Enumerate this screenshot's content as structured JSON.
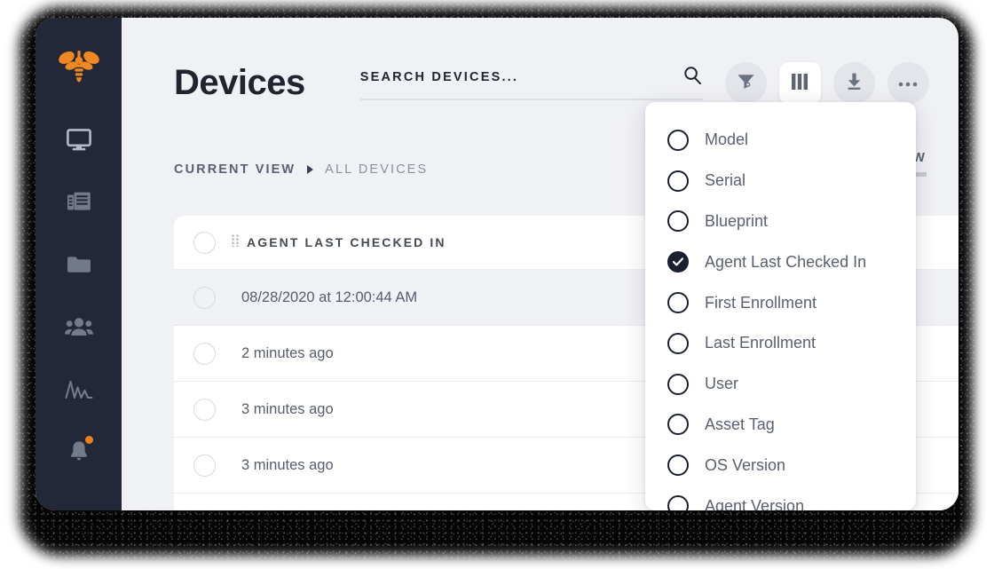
{
  "sidebar": {
    "logo_icon": "bee-logo-icon",
    "items": [
      {
        "icon": "monitor-icon",
        "name": "devices"
      },
      {
        "icon": "documents-icon",
        "name": "blueprints"
      },
      {
        "icon": "folder-icon",
        "name": "library"
      },
      {
        "icon": "users-icon",
        "name": "users"
      },
      {
        "icon": "activity-icon",
        "name": "activity"
      },
      {
        "icon": "bell-icon",
        "name": "notifications",
        "badge": true
      }
    ],
    "background_color": "#232838",
    "logo_color": "#f0811a",
    "badge_color": "#f0811a"
  },
  "header": {
    "title": "Devices",
    "search": {
      "placeholder": "SEARCH DEVICES...",
      "value": "",
      "icon": "search-icon"
    },
    "tools": [
      {
        "label": "Filter",
        "icon": "filter-icon",
        "active": false
      },
      {
        "label": "Columns",
        "icon": "columns-icon",
        "active": true
      },
      {
        "label": "Export",
        "icon": "download-icon",
        "active": false
      },
      {
        "label": "More",
        "icon": "ellipsis-icon",
        "active": false
      }
    ]
  },
  "viewbar": {
    "label": "CURRENT VIEW",
    "value": "ALL DEVICES",
    "reset_label": "RESET VIEW"
  },
  "table": {
    "column_header": "AGENT LAST CHECKED IN",
    "rows": [
      {
        "value": "08/28/2020 at 12:00:44 AM",
        "shaded": true
      },
      {
        "value": "2 minutes ago",
        "shaded": false
      },
      {
        "value": "3 minutes ago",
        "shaded": false
      },
      {
        "value": "3 minutes ago",
        "shaded": false
      },
      {
        "value": "",
        "shaded": false
      }
    ]
  },
  "columns_menu": {
    "items": [
      {
        "label": "Model",
        "checked": false
      },
      {
        "label": "Serial",
        "checked": false
      },
      {
        "label": "Blueprint",
        "checked": false
      },
      {
        "label": "Agent Last Checked In",
        "checked": true
      },
      {
        "label": "First Enrollment",
        "checked": false
      },
      {
        "label": "Last Enrollment",
        "checked": false
      },
      {
        "label": "User",
        "checked": false
      },
      {
        "label": "Asset Tag",
        "checked": false
      },
      {
        "label": "OS Version",
        "checked": false
      },
      {
        "label": "Agent Version",
        "checked": false
      }
    ]
  },
  "colors": {
    "accent": "#f0811a",
    "sidebar": "#232838",
    "page_bg": "#f0f1f5",
    "text_dark": "#20242f",
    "text_muted": "#5a6070"
  }
}
